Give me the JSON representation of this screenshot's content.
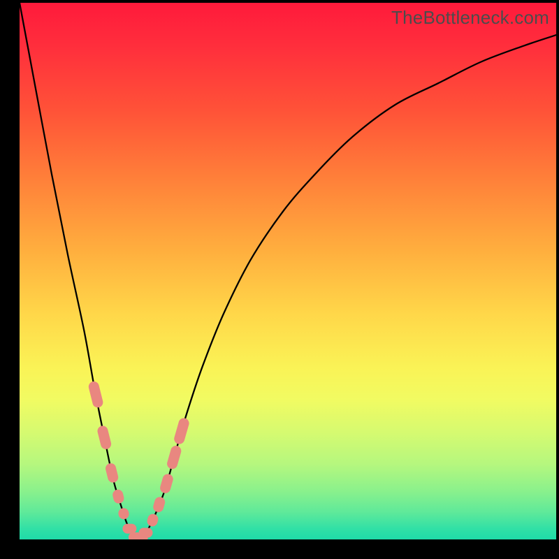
{
  "watermark": "TheBottleneck.com",
  "chart_data": {
    "type": "line",
    "title": "",
    "xlabel": "",
    "ylabel": "",
    "xlim": [
      0,
      100
    ],
    "ylim": [
      0,
      100
    ],
    "x": [
      0,
      3,
      6,
      9,
      12,
      14,
      16,
      17.5,
      19,
      20,
      21,
      22,
      23,
      24,
      25,
      27,
      29,
      31,
      34,
      38,
      43,
      49,
      55,
      62,
      70,
      78,
      86,
      94,
      100
    ],
    "y": [
      100,
      84,
      68,
      53,
      39,
      28,
      18,
      11,
      6,
      3,
      1,
      0,
      0.5,
      2,
      4,
      9,
      16,
      23,
      32,
      42,
      52,
      61,
      68,
      75,
      81,
      85,
      89,
      92,
      94
    ],
    "annotations": [
      {
        "type": "marker",
        "x_range": [
          14,
          19.5
        ],
        "y_range": [
          4,
          24
        ],
        "style": "rounded-salmon",
        "note": "left-branch dots"
      },
      {
        "type": "marker",
        "x_range": [
          21,
          23.5
        ],
        "y_range": [
          0,
          3
        ],
        "style": "rounded-salmon",
        "note": "trough dots"
      },
      {
        "type": "marker",
        "x_range": [
          24.5,
          30
        ],
        "y_range": [
          4,
          24
        ],
        "style": "rounded-salmon",
        "note": "right-branch dots"
      }
    ],
    "marker_color": "#e98780",
    "curve_color": "#000000"
  }
}
